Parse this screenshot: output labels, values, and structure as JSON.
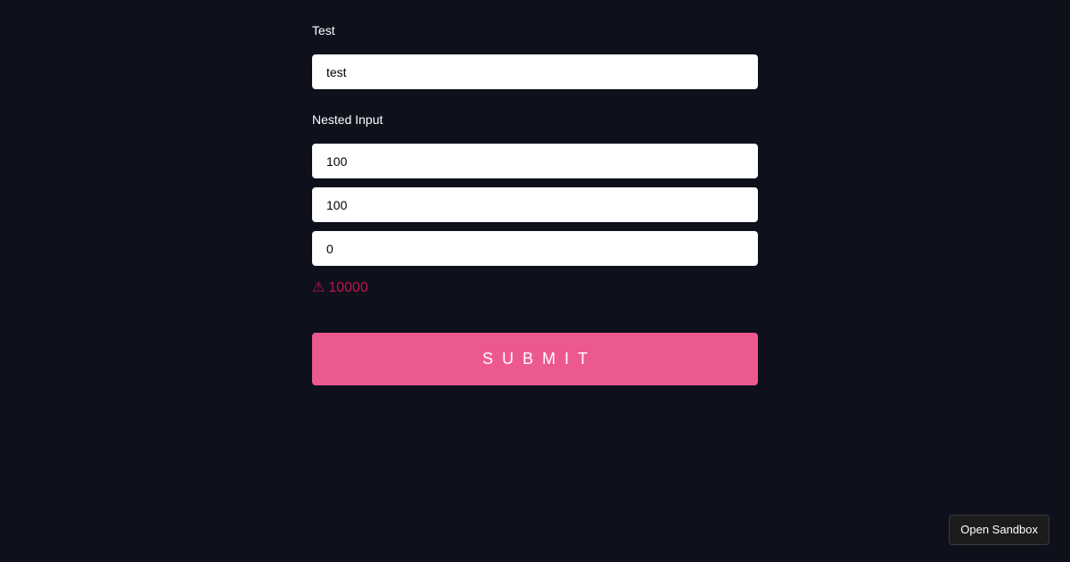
{
  "form": {
    "test_label": "Test",
    "test_value": "test",
    "nested_label": "Nested Input",
    "nested_values": [
      "100",
      "100",
      "0"
    ],
    "error_icon": "⚠",
    "error_text": "10000",
    "submit_label": "SUBMIT"
  },
  "sandbox": {
    "label": "Open Sandbox"
  },
  "colors": {
    "background": "#0e101c",
    "accent": "#ec5990",
    "error": "#bf1650"
  },
  "icons": {
    "error": "warning-icon"
  }
}
